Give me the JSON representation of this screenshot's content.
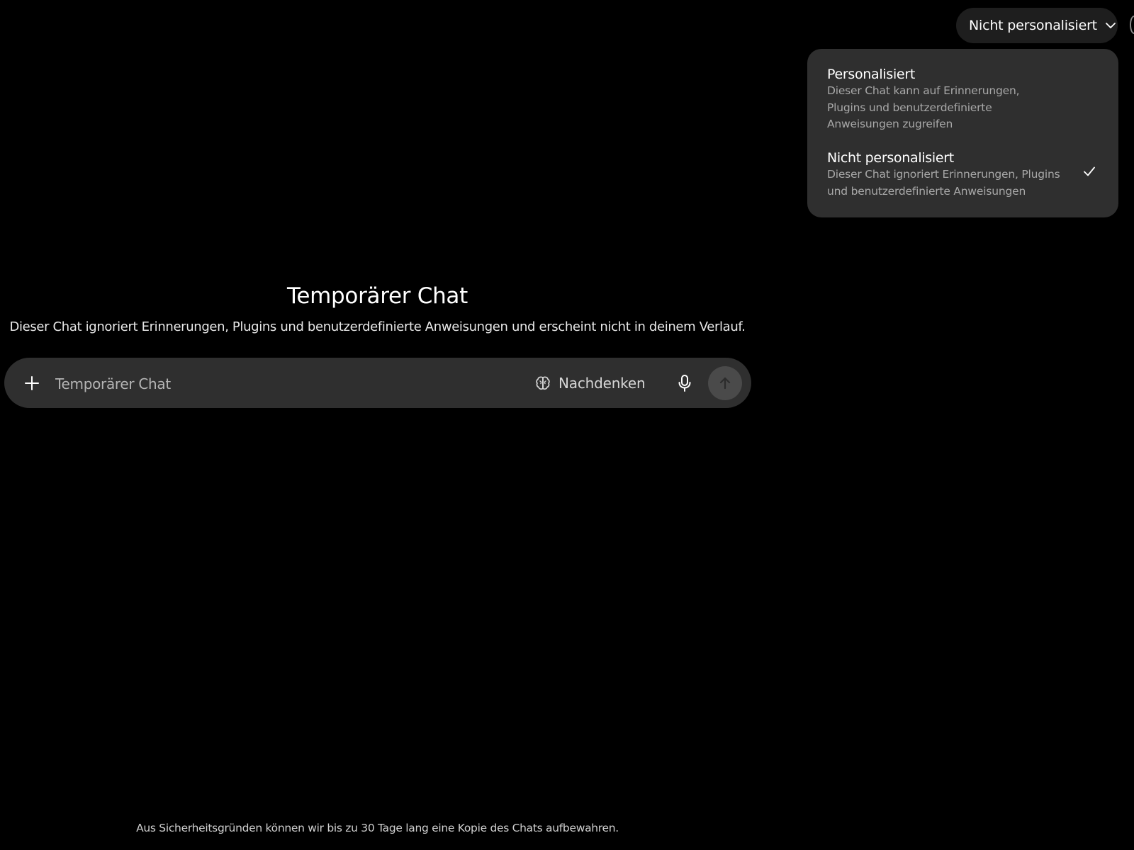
{
  "header": {
    "mode_selector_label": "Nicht personalisiert",
    "mode_selector_icon": "chevron-down-icon"
  },
  "dropdown": {
    "options": [
      {
        "title": "Personalisiert",
        "description": "Dieser Chat kann auf Erinnerungen, Plugins und benutzerdefinierte Anweisungen zugreifen",
        "selected": false
      },
      {
        "title": "Nicht personalisiert",
        "description": "Dieser Chat ignoriert Erinnerungen, Plugins und benutzerdefinierte Anweisungen",
        "selected": true
      }
    ],
    "selected_icon": "checkmark-icon"
  },
  "main": {
    "title": "Temporärer Chat",
    "subtitle": "Dieser Chat ignoriert Erinnerungen, Plugins und benutzerdefinierte Anweisungen und erscheint nicht in deinem Verlauf."
  },
  "composer": {
    "placeholder": "Temporärer Chat",
    "value": "",
    "think_label": "Nachdenken",
    "icons": {
      "add": "plus-icon",
      "think": "brain-icon",
      "mic": "microphone-icon",
      "send": "arrow-up-icon"
    }
  },
  "footer": {
    "note": "Aus Sicherheitsgründen können wir bis zu 30 Tage lang eine Kopie des Chats aufbewahren."
  },
  "colors": {
    "background": "#000000",
    "surface": "#2f2f2f",
    "selector_bg": "#1e1e1e",
    "muted_text": "#a8a8a8",
    "send_disabled": "#4a4a4a"
  }
}
